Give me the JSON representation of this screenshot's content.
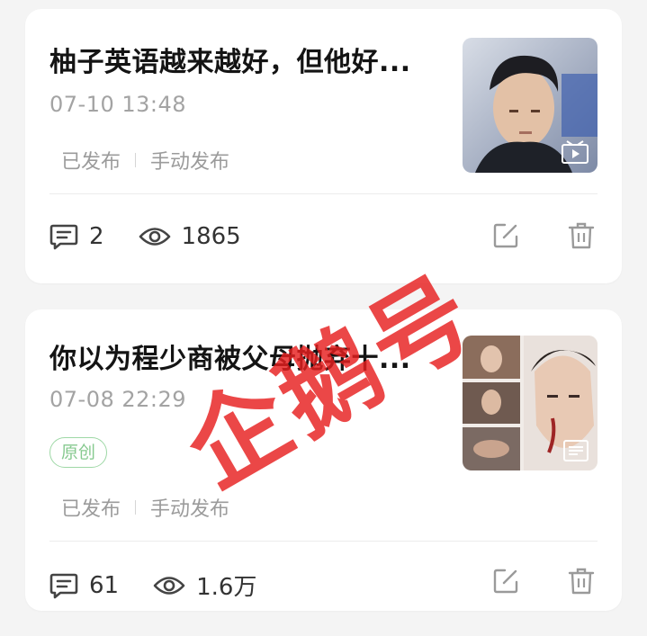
{
  "articles": [
    {
      "title": "柚子英语越来越好，但他好...",
      "time": "07-10 13:48",
      "status": "已发布",
      "publish_mode": "手动发布",
      "comments": "2",
      "views": "1865",
      "thumb_type": "video"
    },
    {
      "title": "你以为程少商被父母抛弃十...",
      "time": "07-08 22:29",
      "badge": "原创",
      "status": "已发布",
      "publish_mode": "手动发布",
      "comments": "61",
      "views": "1.6万",
      "thumb_type": "article"
    }
  ],
  "watermark": "企鹅号",
  "icons": {
    "comment": "comment-icon",
    "views": "eye-icon",
    "edit": "edit-icon",
    "delete": "trash-icon",
    "video": "video-play-icon",
    "article": "article-icon"
  },
  "colors": {
    "badge": "#86c98f",
    "watermark": "#e61e1e",
    "muted": "#9b9b9b"
  }
}
